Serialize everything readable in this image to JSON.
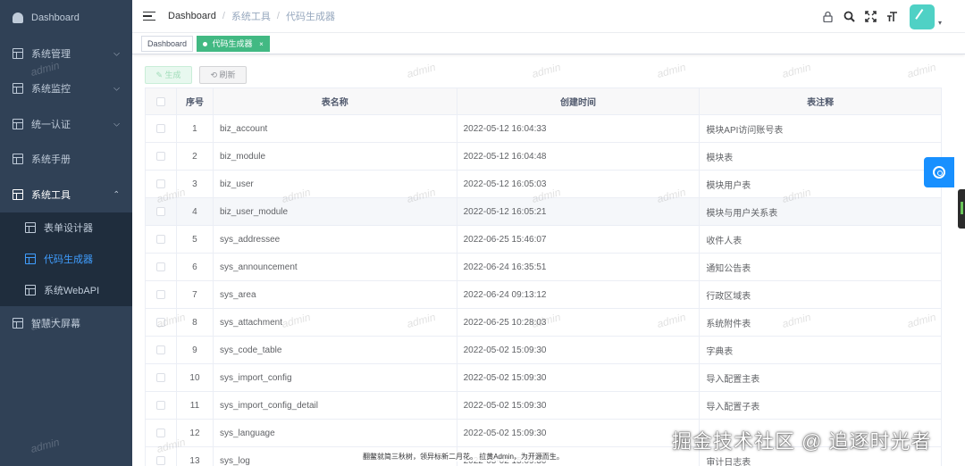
{
  "sidebar": {
    "items": [
      {
        "label": "Dashboard",
        "icon": "dashboard-icon"
      },
      {
        "label": "系统管理",
        "icon": "table-icon"
      },
      {
        "label": "系统监控",
        "icon": "table-icon"
      },
      {
        "label": "统一认证",
        "icon": "table-icon"
      },
      {
        "label": "系统手册",
        "icon": "table-icon"
      },
      {
        "label": "系统工具",
        "icon": "table-icon"
      }
    ],
    "sub_items": [
      {
        "label": "表单设计器",
        "icon": "table-icon"
      },
      {
        "label": "代码生成器",
        "icon": "table-icon"
      },
      {
        "label": "系统WebAPI",
        "icon": "table-icon"
      }
    ],
    "last_item": {
      "label": "智慧大屏幕",
      "icon": "table-icon"
    },
    "chevron_down": "⌵",
    "chevron_up": "⌃",
    "active_color": "#409eff"
  },
  "navbar": {
    "breadcrumb": [
      "Dashboard",
      "系统工具",
      "代码生成器"
    ],
    "separator": "/"
  },
  "tags": {
    "items": [
      {
        "label": "Dashboard",
        "active": false
      },
      {
        "label": "代码生成器",
        "active": true
      }
    ],
    "close_glyph": "×",
    "active_color": "#42b983"
  },
  "toolbar": {
    "generate_label": "生成",
    "refresh_label": "刷新",
    "generate_icon": "✎",
    "refresh_icon": "⟲"
  },
  "table": {
    "headers": [
      "序号",
      "表名称",
      "创建时间",
      "表注释"
    ],
    "rows": [
      {
        "no": "1",
        "name": "biz_account",
        "time": "2022-05-12 16:04:33",
        "comment": "模块API访问账号表"
      },
      {
        "no": "2",
        "name": "biz_module",
        "time": "2022-05-12 16:04:48",
        "comment": "模块表"
      },
      {
        "no": "3",
        "name": "biz_user",
        "time": "2022-05-12 16:05:03",
        "comment": "模块用户表"
      },
      {
        "no": "4",
        "name": "biz_user_module",
        "time": "2022-05-12 16:05:21",
        "comment": "模块与用户关系表"
      },
      {
        "no": "5",
        "name": "sys_addressee",
        "time": "2022-06-25 15:46:07",
        "comment": "收件人表"
      },
      {
        "no": "6",
        "name": "sys_announcement",
        "time": "2022-06-24 16:35:51",
        "comment": "通知公告表"
      },
      {
        "no": "7",
        "name": "sys_area",
        "time": "2022-06-24 09:13:12",
        "comment": "行政区域表"
      },
      {
        "no": "8",
        "name": "sys_attachment",
        "time": "2022-06-25 10:28:03",
        "comment": "系统附件表"
      },
      {
        "no": "9",
        "name": "sys_code_table",
        "time": "2022-05-02 15:09:30",
        "comment": "字典表"
      },
      {
        "no": "10",
        "name": "sys_import_config",
        "time": "2022-05-02 15:09:30",
        "comment": "导入配置主表"
      },
      {
        "no": "11",
        "name": "sys_import_config_detail",
        "time": "2022-05-02 15:09:30",
        "comment": "导入配置子表"
      },
      {
        "no": "12",
        "name": "sys_language",
        "time": "2022-05-02 15:09:30",
        "comment": ""
      },
      {
        "no": "13",
        "name": "sys_log",
        "time": "2022-05-02 15:09:30",
        "comment": "审计日志表"
      }
    ],
    "hover_row_index": 3
  },
  "watermark": "admin",
  "footer_text": "翻鳖就简三秋树，领异标新二月花。 拉黄Admin，为开源而生。",
  "brand_text": "掘金技术社区 @ 追逐时光者"
}
